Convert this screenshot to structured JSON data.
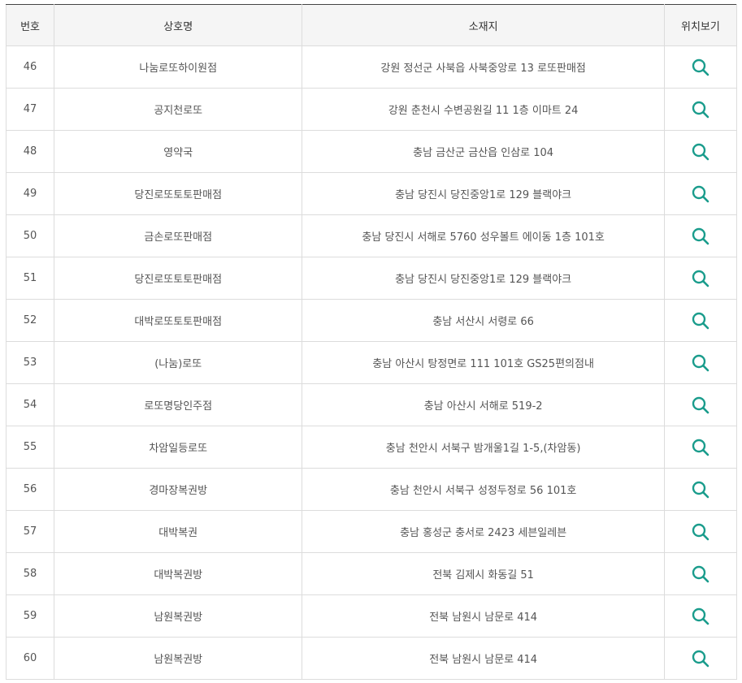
{
  "colors": {
    "accent": "#1a9c8c",
    "header_bg": "#f5f5f5",
    "border": "#dcdcdc",
    "text": "#555555"
  },
  "table": {
    "headers": [
      "번호",
      "상호명",
      "소재지",
      "위치보기"
    ],
    "view_icon": "search-icon",
    "rows": [
      {
        "no": "46",
        "name": "나눔로또하이원점",
        "address": "강원 정선군 사북읍 사북중앙로 13 로또판매점"
      },
      {
        "no": "47",
        "name": "공지천로또",
        "address": "강원 춘천시 수변공원길 11 1층 이마트 24"
      },
      {
        "no": "48",
        "name": "영약국",
        "address": "충남 금산군 금산읍 인삼로 104"
      },
      {
        "no": "49",
        "name": "당진로또토토판매점",
        "address": "충남 당진시 당진중앙1로 129 블랙야크"
      },
      {
        "no": "50",
        "name": "금손로또판매점",
        "address": "충남 당진시 서해로 5760 성우볼트 에이동 1층 101호"
      },
      {
        "no": "51",
        "name": "당진로또토토판매점",
        "address": "충남 당진시 당진중앙1로 129 블랙야크"
      },
      {
        "no": "52",
        "name": "대박로또토토판매점",
        "address": "충남 서산시 서령로 66"
      },
      {
        "no": "53",
        "name": "(나눔)로또",
        "address": "충남 아산시 탕정면로 111 101호 GS25편의점내"
      },
      {
        "no": "54",
        "name": "로또명당인주점",
        "address": "충남 아산시 서해로 519-2"
      },
      {
        "no": "55",
        "name": "차암일등로또",
        "address": "충남 천안시 서북구 밤개울1길 1-5,(차암동)"
      },
      {
        "no": "56",
        "name": "경마장복권방",
        "address": "충남 천안시 서북구 성정두정로 56 101호"
      },
      {
        "no": "57",
        "name": "대박복권",
        "address": "충남 홍성군 충서로 2423 세븐일레븐"
      },
      {
        "no": "58",
        "name": "대박복권방",
        "address": "전북 김제시 화동길 51"
      },
      {
        "no": "59",
        "name": "남원복권방",
        "address": "전북 남원시 남문로 414"
      },
      {
        "no": "60",
        "name": "남원복권방",
        "address": "전북 남원시 남문로 414"
      }
    ]
  }
}
